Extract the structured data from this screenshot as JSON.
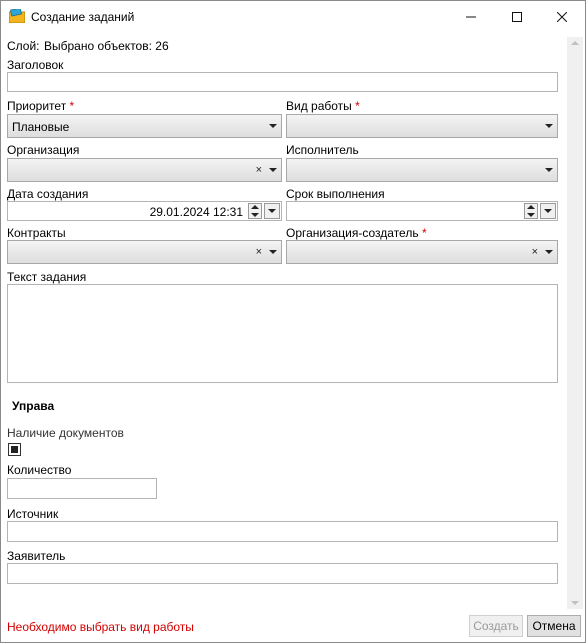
{
  "window": {
    "title": "Создание заданий"
  },
  "layer": {
    "label": "Слой:",
    "value": "Выбрано объектов: 26"
  },
  "fields": {
    "title": {
      "label": "Заголовок",
      "value": ""
    },
    "priority": {
      "label": "Приоритет",
      "required": "*",
      "value": "Плановые"
    },
    "work_type": {
      "label": "Вид работы",
      "required": "*",
      "value": ""
    },
    "organization": {
      "label": "Организация",
      "value": ""
    },
    "executor": {
      "label": "Исполнитель",
      "value": ""
    },
    "created_date": {
      "label": "Дата создания",
      "value": "29.01.2024 12:31"
    },
    "deadline": {
      "label": "Срок выполнения",
      "value": ""
    },
    "contracts": {
      "label": "Контракты",
      "value": ""
    },
    "creator_org": {
      "label": "Организация-создатель",
      "required": "*",
      "value": ""
    },
    "task_text": {
      "label": "Текст задания",
      "value": ""
    }
  },
  "section": {
    "title": "Управа"
  },
  "extra": {
    "documents": {
      "label": "Наличие документов",
      "checked": true
    },
    "quantity": {
      "label": "Количество",
      "value": ""
    },
    "source": {
      "label": "Источник",
      "value": ""
    },
    "applicant": {
      "label": "Заявитель",
      "value": ""
    }
  },
  "footer": {
    "error": "Необходимо выбрать вид работы",
    "create_label": "Создать",
    "cancel_label": "Отмена"
  },
  "icons": {
    "clear": "×"
  },
  "colors": {
    "error": "#d40000",
    "required": "#d40000"
  }
}
